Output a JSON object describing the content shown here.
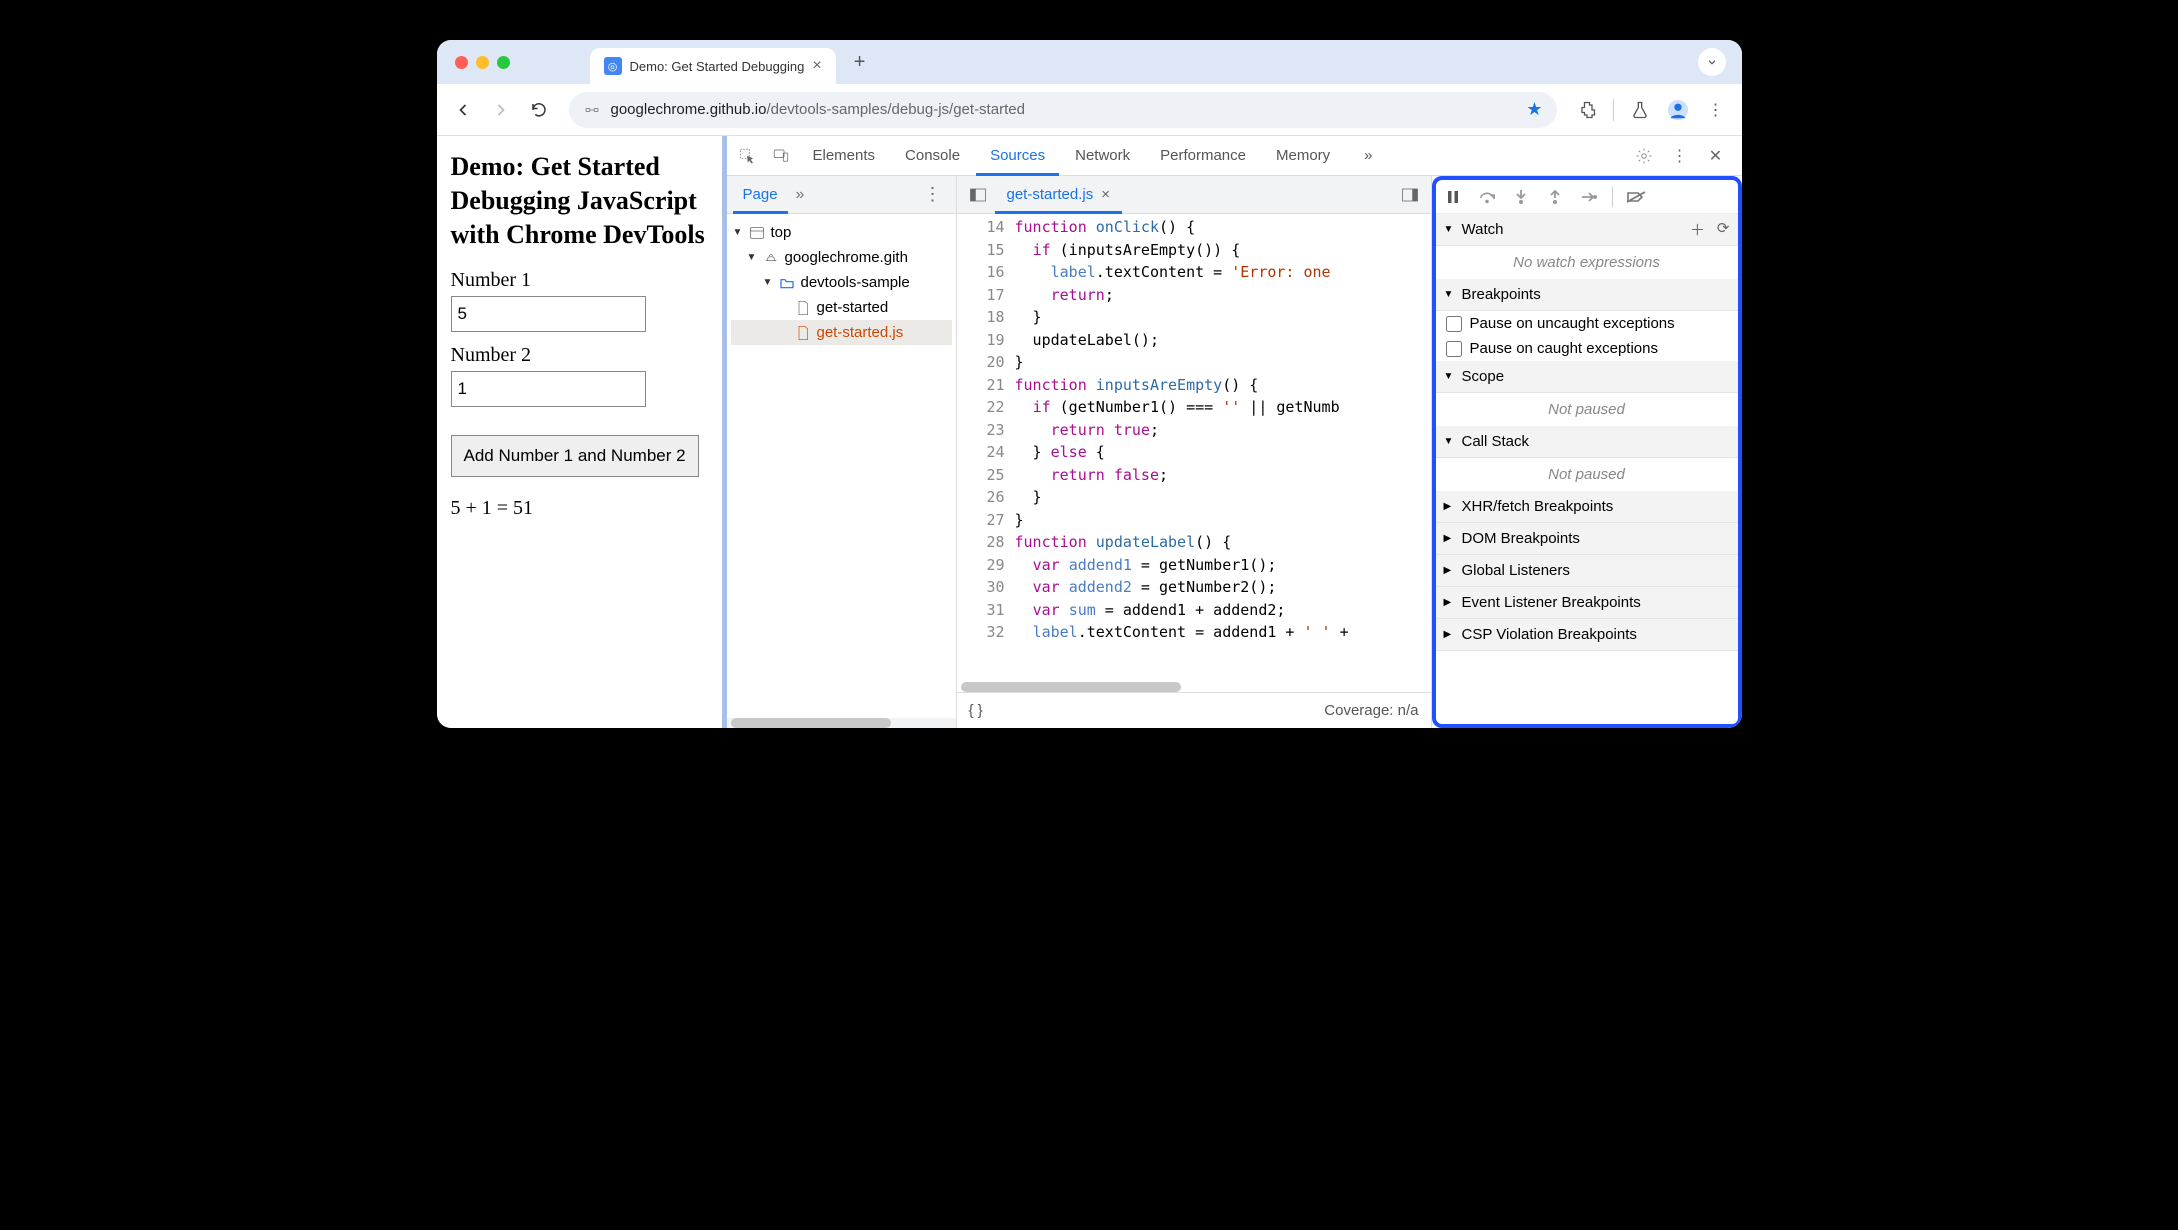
{
  "browser": {
    "tab_title": "Demo: Get Started Debugging",
    "url_host": "googlechrome.github.io",
    "url_path": "/devtools-samples/debug-js/get-started"
  },
  "page": {
    "heading": "Demo: Get Started Debugging JavaScript with Chrome DevTools",
    "label1": "Number 1",
    "value1": "5",
    "label2": "Number 2",
    "value2": "1",
    "button": "Add Number 1 and Number 2",
    "result": "5 + 1 = 51"
  },
  "devtools": {
    "tabs": [
      "Elements",
      "Console",
      "Sources",
      "Network",
      "Performance",
      "Memory"
    ],
    "active_tab": "Sources",
    "navigator": {
      "tab": "Page",
      "tree": {
        "top": "top",
        "domain": "googlechrome.gith",
        "folder": "devtools-sample",
        "file_html": "get-started",
        "file_js": "get-started.js"
      }
    },
    "editor": {
      "open_file": "get-started.js",
      "coverage": "Coverage: n/a",
      "lines": [
        {
          "n": 14,
          "html": "<span class='kw'>function</span> <span class='fn'>onClick</span>() {"
        },
        {
          "n": 15,
          "html": "  <span class='kw'>if</span> (inputsAreEmpty()) {"
        },
        {
          "n": 16,
          "html": "    <span class='var'>label</span>.textContent = <span class='str'>'Error: one</span>"
        },
        {
          "n": 17,
          "html": "    <span class='kw'>return</span>;"
        },
        {
          "n": 18,
          "html": "  }"
        },
        {
          "n": 19,
          "html": "  updateLabel();"
        },
        {
          "n": 20,
          "html": "}"
        },
        {
          "n": 21,
          "html": "<span class='kw'>function</span> <span class='fn'>inputsAreEmpty</span>() {"
        },
        {
          "n": 22,
          "html": "  <span class='kw'>if</span> (getNumber1() === <span class='str'>''</span> || getNumb"
        },
        {
          "n": 23,
          "html": "    <span class='kw'>return</span> <span class='bool'>true</span>;"
        },
        {
          "n": 24,
          "html": "  } <span class='kw'>else</span> {"
        },
        {
          "n": 25,
          "html": "    <span class='kw'>return</span> <span class='bool'>false</span>;"
        },
        {
          "n": 26,
          "html": "  }"
        },
        {
          "n": 27,
          "html": "}"
        },
        {
          "n": 28,
          "html": "<span class='kw'>function</span> <span class='fn'>updateLabel</span>() {"
        },
        {
          "n": 29,
          "html": "  <span class='kw'>var</span> <span class='var'>addend1</span> = getNumber1();"
        },
        {
          "n": 30,
          "html": "  <span class='kw'>var</span> <span class='var'>addend2</span> = getNumber2();"
        },
        {
          "n": 31,
          "html": "  <span class='kw'>var</span> <span class='var'>sum</span> = addend1 + addend2;"
        },
        {
          "n": 32,
          "html": "  <span class='var'>label</span>.textContent = addend1 + <span class='str'>' '</span> +"
        }
      ]
    },
    "debugger": {
      "watch": {
        "title": "Watch",
        "empty": "No watch expressions"
      },
      "breakpoints": {
        "title": "Breakpoints",
        "opt1": "Pause on uncaught exceptions",
        "opt2": "Pause on caught exceptions"
      },
      "scope": {
        "title": "Scope",
        "empty": "Not paused"
      },
      "callstack": {
        "title": "Call Stack",
        "empty": "Not paused"
      },
      "collapsed": [
        "XHR/fetch Breakpoints",
        "DOM Breakpoints",
        "Global Listeners",
        "Event Listener Breakpoints",
        "CSP Violation Breakpoints"
      ]
    }
  }
}
